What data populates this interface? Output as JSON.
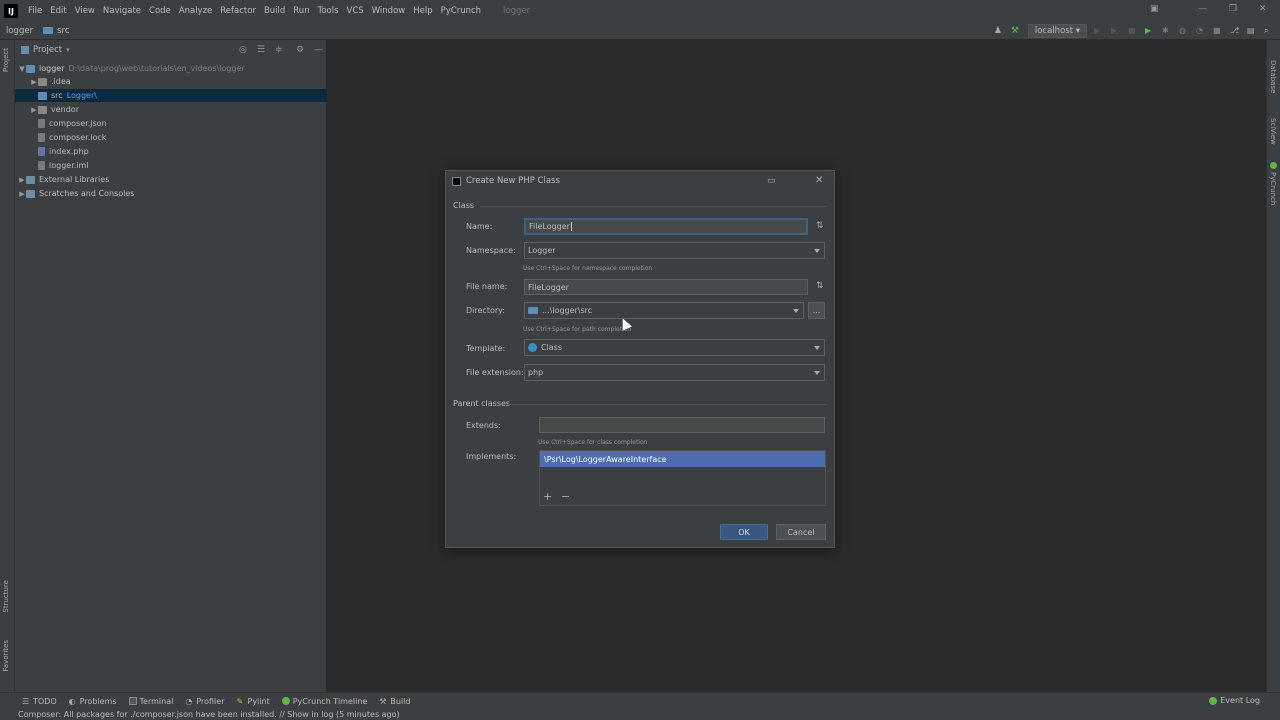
{
  "menubar": {
    "items": [
      "File",
      "Edit",
      "View",
      "Navigate",
      "Code",
      "Analyze",
      "Refactor",
      "Build",
      "Run",
      "Tools",
      "VCS",
      "Window",
      "Help",
      "PyCrunch"
    ],
    "project_title": "logger"
  },
  "navbar": {
    "crumbs": [
      "logger",
      "src"
    ],
    "run_config": "localhost"
  },
  "project_panel": {
    "title": "Project",
    "tree": [
      {
        "label": "logger",
        "hint": "D:\\data\\prog\\web\\tutorials\\en_videos\\logger"
      },
      {
        "label": ".idea"
      },
      {
        "label": "src",
        "hint": "Logger\\"
      },
      {
        "label": "vendor"
      },
      {
        "label": "composer.json"
      },
      {
        "label": "composer.lock"
      },
      {
        "label": "index.php"
      },
      {
        "label": "logger.iml"
      },
      {
        "label": "External Libraries"
      },
      {
        "label": "Scratches and Consoles"
      }
    ]
  },
  "left_stripe": {
    "project": "Project",
    "structure": "Structure",
    "favorites": "Favorites"
  },
  "right_stripe": {
    "database": "Database",
    "sciview": "SciView",
    "pycrunch": "PyCrunch"
  },
  "dialog": {
    "title": "Create New PHP Class",
    "section_class": "Class",
    "name_label": "Name:",
    "name_value": "FileLogger",
    "namespace_label": "Namespace:",
    "namespace_value": "Logger",
    "namespace_hint": "Use Ctrl+Space for namespace completion",
    "filename_label": "File name:",
    "filename_value": "FileLogger",
    "directory_label": "Directory:",
    "directory_value": "...\\logger\\src",
    "directory_browse": "...",
    "directory_hint": "Use Ctrl+Space for path completion",
    "template_label": "Template:",
    "template_value": "Class",
    "extension_label": "File extension:",
    "extension_value": "php",
    "section_parents": "Parent classes",
    "extends_label": "Extends:",
    "extends_value": "",
    "extends_hint": "Use Ctrl+Space for class completion",
    "implements_label": "Implements:",
    "implements_items": [
      "\\Psr\\Log\\LoggerAwareInterface"
    ],
    "add_symbol": "+",
    "remove_symbol": "−",
    "ok_label": "OK",
    "cancel_label": "Cancel"
  },
  "bottom_bar": {
    "tabs": [
      "TODO",
      "Problems",
      "Terminal",
      "Profiler",
      "Pylint",
      "PyCrunch Timeline",
      "Build"
    ],
    "event_log": "Event Log"
  },
  "status": {
    "message": "Composer: All packages for ./composer.json have been installed. // Show in log (5 minutes ago)"
  },
  "colors": {
    "selection": "#4b6eaf",
    "focus_border": "#3d6185",
    "primary_button": "#365880"
  }
}
